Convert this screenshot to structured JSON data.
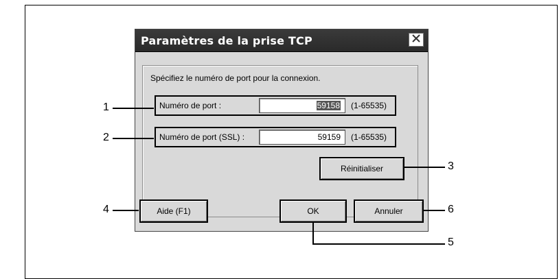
{
  "dialog": {
    "title": "Paramètres de la prise TCP",
    "instruction": "Spécifiez le numéro de port pour la connexion.",
    "port": {
      "label": "Numéro de port :",
      "value": "59158",
      "range": "(1-65535)"
    },
    "port_ssl": {
      "label": "Numéro de port (SSL) :",
      "value": "59159",
      "range": "(1-65535)"
    },
    "reset_label": "Réinitialiser",
    "help_label": "Aide (F1)",
    "ok_label": "OK",
    "cancel_label": "Annuler"
  },
  "callouts": [
    "1",
    "2",
    "3",
    "4",
    "5",
    "6"
  ]
}
